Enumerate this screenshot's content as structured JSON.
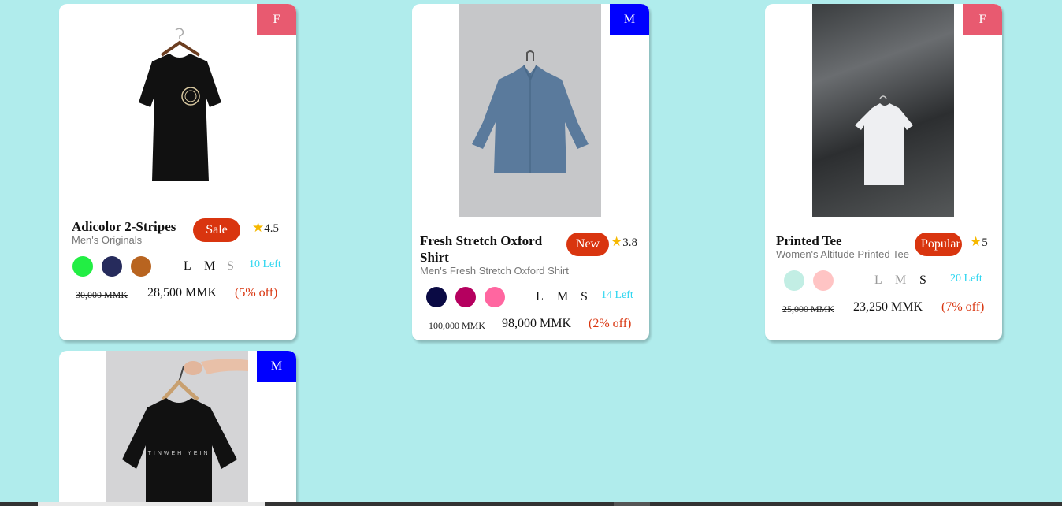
{
  "products": [
    {
      "gender": "F",
      "gender_color": "#e85a70",
      "name": "Adicolor 2-Stripes",
      "subtitle": "Men's Originals",
      "tag": "Sale",
      "rating": "4.5",
      "swatches": [
        "#22ee44",
        "#262b5c",
        "#b86420"
      ],
      "sizes": [
        {
          "label": "L",
          "available": true
        },
        {
          "label": "M",
          "available": true
        },
        {
          "label": "S",
          "available": false
        }
      ],
      "left": "10 Left",
      "old_price": "30,000 MMK",
      "price": "28,500 MMK",
      "discount": "(5% off)",
      "image_icon": "black-tshirt-on-hanger-image"
    },
    {
      "gender": "M",
      "gender_color": "#0000ff",
      "name": "Fresh Stretch Oxford Shirt",
      "subtitle": "Men's Fresh Stretch Oxford Shirt",
      "tag": "New",
      "rating": "3.8",
      "swatches": [
        "#0a0a44",
        "#b5005f",
        "#ff66a0"
      ],
      "sizes": [
        {
          "label": "L",
          "available": true
        },
        {
          "label": "M",
          "available": true
        },
        {
          "label": "S",
          "available": true
        }
      ],
      "left": "14 Left",
      "old_price": "100,000 MMK",
      "price": "98,000 MMK",
      "discount": "(2% off)",
      "image_icon": "blue-oxford-shirt-image"
    },
    {
      "gender": "F",
      "gender_color": "#e85a70",
      "name": "Printed Tee",
      "subtitle": "Women's Altitude Printed Tee",
      "tag": "Popular",
      "rating": "5",
      "swatches": [
        "#c2eee4",
        "#ffc4c4"
      ],
      "sizes": [
        {
          "label": "L",
          "available": false
        },
        {
          "label": "M",
          "available": false
        },
        {
          "label": "S",
          "available": true
        }
      ],
      "left": "20 Left",
      "old_price": "25,000 MMK",
      "price": "23,250 MMK",
      "discount": "(7% off)",
      "image_icon": "white-tee-on-dark-wall-image"
    },
    {
      "gender": "M",
      "gender_color": "#0000ff",
      "image_icon": "black-printed-tshirt-on-hanger-image",
      "print_text": "TINWEH YEIN"
    }
  ]
}
